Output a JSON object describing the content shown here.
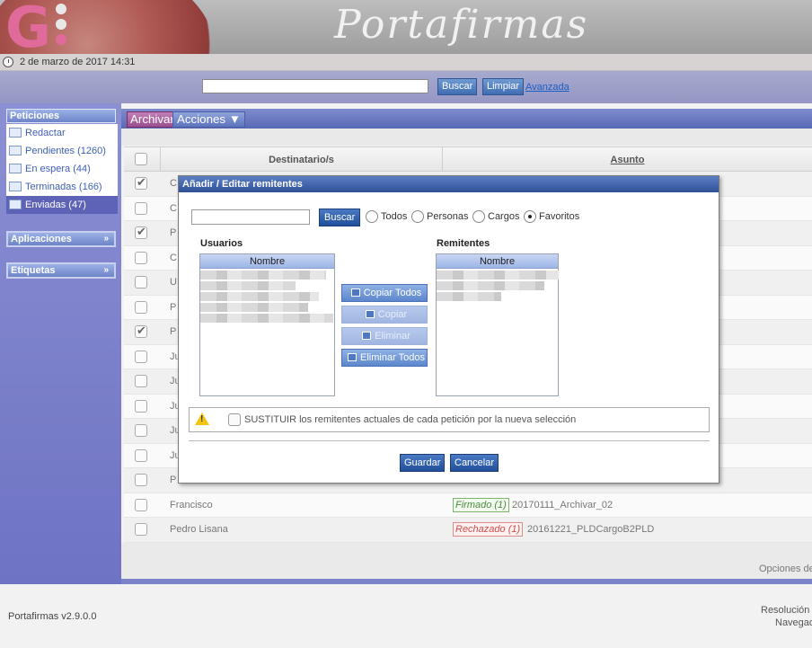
{
  "header": {
    "app_title": "Portafirmas",
    "logo_letter": "G"
  },
  "datebar": {
    "date": "2 de marzo de 2017 14:31"
  },
  "search": {
    "value": "",
    "buscar": "Buscar",
    "limpiar": "Limpiar",
    "avanzada": "Avanzada"
  },
  "sidebar": {
    "peticiones": "Peticiones",
    "items": [
      {
        "label": "Redactar",
        "icon": "compose-icon"
      },
      {
        "label": "Pendientes (1260)",
        "icon": "envelope-icon"
      },
      {
        "label": "En espera (44)",
        "icon": "waiting-icon"
      },
      {
        "label": "Terminadas (166)",
        "icon": "finished-icon"
      },
      {
        "label": "Enviadas (47)",
        "icon": "sent-icon"
      }
    ],
    "aplicaciones": "Aplicaciones",
    "etiquetas": "Etiquetas",
    "chevron": "»"
  },
  "toolbar": {
    "archivar": "Archivar",
    "acciones": "Acciones"
  },
  "table": {
    "headers": {
      "destinatarios": "Destinatario/s",
      "asunto": "Asunto"
    },
    "rows": [
      {
        "checked": true,
        "dest": "C"
      },
      {
        "checked": false,
        "dest": "C"
      },
      {
        "checked": true,
        "dest": "P"
      },
      {
        "checked": false,
        "dest": "C"
      },
      {
        "checked": false,
        "dest": "U"
      },
      {
        "checked": false,
        "dest": "P"
      },
      {
        "checked": true,
        "dest": "P"
      },
      {
        "checked": false,
        "dest": "Ju"
      },
      {
        "checked": false,
        "dest": "Ju"
      },
      {
        "checked": false,
        "dest": "Ju"
      },
      {
        "checked": false,
        "dest": "Ju"
      },
      {
        "checked": false,
        "dest": "Ju"
      },
      {
        "checked": false,
        "dest": "P"
      },
      {
        "checked": false,
        "dest": "Francisco",
        "state": "Firmado (1)",
        "state_type": "signed",
        "subject": "20170111_Archivar_02"
      },
      {
        "checked": false,
        "dest": "Pedro Lisana",
        "state": "Rechazado (1)",
        "state_type": "rejected",
        "subject": "20161221_PLDCargoB2PLD"
      }
    ],
    "opciones": "Opciones de"
  },
  "footer": {
    "version": "Portafirmas v2.9.0.0",
    "resolucion": "Resolución",
    "navegador": "Navegad"
  },
  "modal": {
    "title": "Añadir / Editar remitentes",
    "search_value": "",
    "buscar": "Buscar",
    "radios": [
      {
        "label": "Todos",
        "selected": false
      },
      {
        "label": "Personas",
        "selected": false
      },
      {
        "label": "Cargos",
        "selected": false
      },
      {
        "label": "Favoritos",
        "selected": true
      }
    ],
    "usuarios_label": "Usuarios",
    "remitentes_label": "Remitentes",
    "col_nombre": "Nombre",
    "buttons": {
      "copiar_todos": "Copiar Todos",
      "copiar": "Copiar",
      "eliminar": "Eliminar",
      "eliminar_todos": "Eliminar Todos"
    },
    "sustituir": "SUSTITUIR los remitentes actuales de cada petición por la nueva selección",
    "guardar": "Guardar",
    "cancelar": "Cancelar"
  }
}
